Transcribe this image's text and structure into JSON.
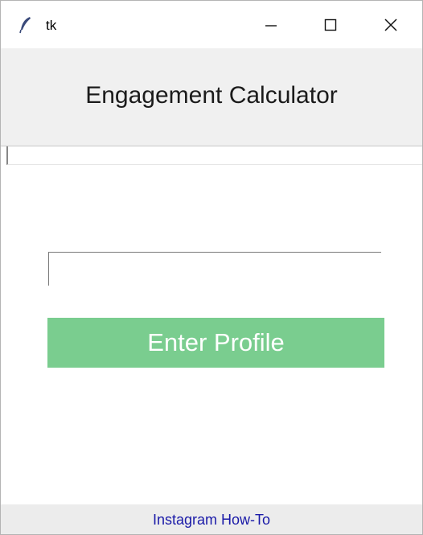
{
  "window": {
    "title": "tk",
    "controls": {
      "minimize": "minimize",
      "maximize": "maximize",
      "close": "close"
    }
  },
  "header": {
    "title": "Engagement Calculator"
  },
  "form": {
    "top_entry_value": "",
    "profile_input_value": "",
    "enter_button_label": "Enter Profile"
  },
  "footer": {
    "link_label": "Instagram How-To"
  },
  "colors": {
    "button_bg": "#7acd8f",
    "button_text": "#ffffff",
    "header_bg": "#f0f0f0",
    "footer_bg": "#ececec",
    "link": "#1a1aa8"
  },
  "icons": {
    "app": "feather-icon",
    "minimize": "minimize-icon",
    "maximize": "maximize-icon",
    "close": "close-icon"
  }
}
